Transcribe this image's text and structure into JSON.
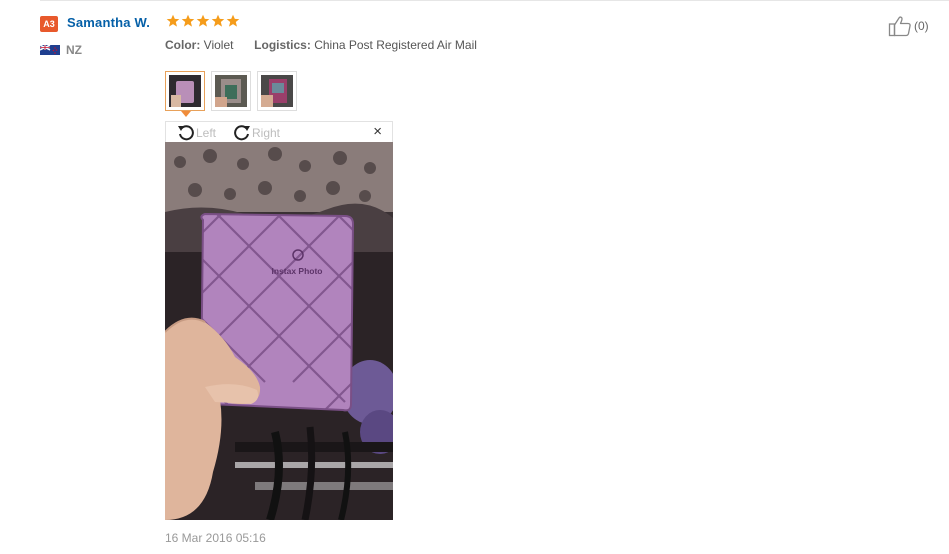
{
  "review": {
    "buyer_level": "A3",
    "buyer_name": "Samantha W.",
    "rating_stars": 5,
    "country_code": "NZ",
    "color_label": "Color:",
    "color_value": "Violet",
    "logistics_label": "Logistics:",
    "logistics_value": "China Post Registered Air Mail",
    "date": "16 Mar 2016 05:16",
    "helpful_count": "(0)"
  },
  "viewer": {
    "rotate_left_label": "Left",
    "rotate_right_label": "Right",
    "close_symbol": "×"
  },
  "photo": {
    "product_text": "Instax Photo"
  },
  "colors": {
    "star": "#f59c1a",
    "buyer_name": "#0560a8",
    "badge": "#e8592c",
    "active_thumb": "#f08c3a"
  }
}
